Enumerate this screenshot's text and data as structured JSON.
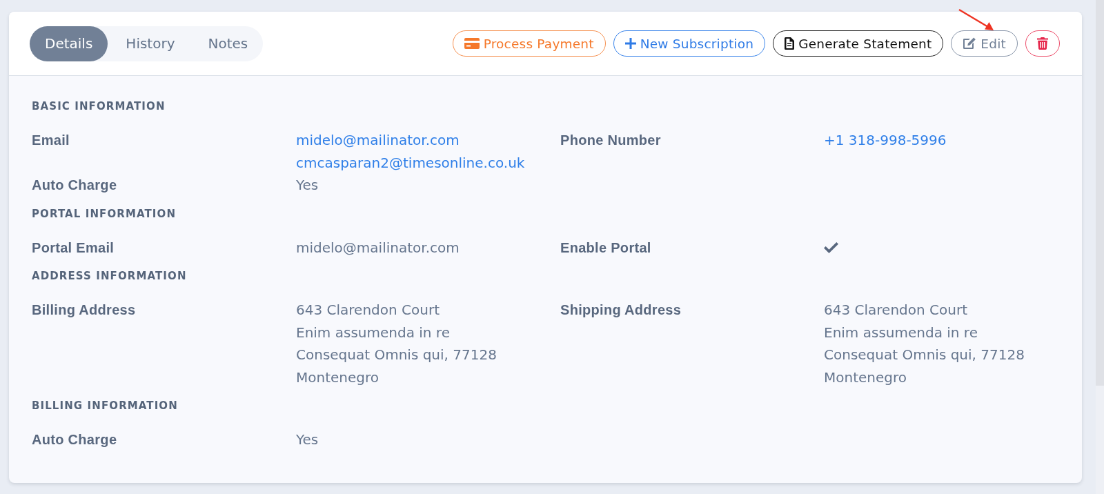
{
  "tabs": [
    {
      "label": "Details",
      "selected": true
    },
    {
      "label": "History",
      "selected": false
    },
    {
      "label": "Notes",
      "selected": false
    }
  ],
  "actions": [
    {
      "kind": "payment",
      "label": "Process Payment"
    },
    {
      "kind": "subscription",
      "label": "New Subscription"
    },
    {
      "kind": "statement",
      "label": "Generate Statement"
    },
    {
      "kind": "edit",
      "label": "Edit"
    },
    {
      "kind": "delete"
    }
  ],
  "sections": [
    {
      "heading": "BASIC INFORMATION",
      "rows": [
        {
          "fields": [
            {
              "label": "Email",
              "kind": "link",
              "lines": [
                "midelo@mailinator.com",
                "cmcasparan2@timesonline.co.uk"
              ]
            },
            {
              "label": "Phone Number",
              "kind": "link",
              "lines": [
                "+1 318-998-5996"
              ]
            }
          ]
        },
        {
          "fields": [
            {
              "label": "Auto Charge",
              "kind": "text",
              "lines": [
                "Yes"
              ]
            }
          ]
        }
      ]
    },
    {
      "heading": "PORTAL INFORMATION",
      "rows": [
        {
          "fields": [
            {
              "label": "Portal Email",
              "kind": "text",
              "lines": [
                "midelo@mailinator.com"
              ]
            },
            {
              "label": "Enable Portal",
              "kind": "check",
              "checked": true
            }
          ]
        }
      ]
    },
    {
      "heading": "ADDRESS INFORMATION",
      "rows": [
        {
          "fields": [
            {
              "label": "Billing Address",
              "kind": "address",
              "lines": [
                "643 Clarendon Court",
                "Enim assumenda in re",
                "Consequat Omnis qui, 77128",
                "Montenegro"
              ]
            },
            {
              "label": "Shipping Address",
              "kind": "address",
              "lines": [
                "643 Clarendon Court",
                "Enim assumenda in re",
                "Consequat Omnis qui, 77128",
                "Montenegro"
              ]
            }
          ]
        }
      ]
    },
    {
      "heading": "BILLING INFORMATION",
      "rows": [
        {
          "fields": [
            {
              "label": "Auto Charge",
              "kind": "text",
              "lines": [
                "Yes"
              ]
            }
          ]
        }
      ]
    }
  ]
}
